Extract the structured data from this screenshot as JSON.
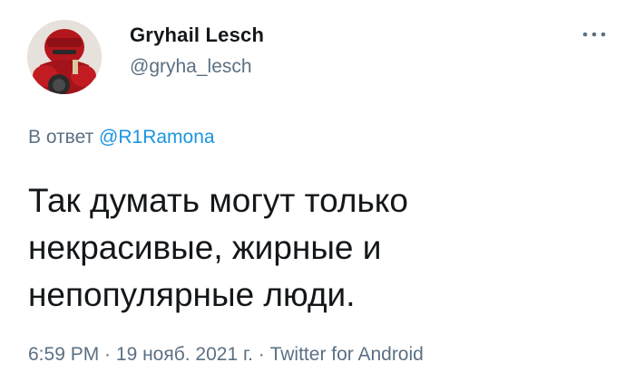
{
  "author": {
    "display_name": "Gryhail Lesch",
    "handle": "@gryha_lesch",
    "avatar_icon": "armored-helmet-avatar"
  },
  "more_icon": "three-dots-icon",
  "reply": {
    "prefix": "В ответ",
    "mention": "@R1Ramona"
  },
  "tweet": {
    "lines": [
      "Так думать могут только",
      "некрасивые, жирные и",
      "непопулярные люди."
    ]
  },
  "meta": {
    "time": "6:59 PM",
    "separator_1": " · ",
    "date": "19 нояб. 2021 г.",
    "separator_2": " · ",
    "source": "Twitter for Android"
  },
  "colors": {
    "text": "#14171a",
    "secondary": "#5b7083",
    "link": "#1b95e0",
    "background": "#ffffff"
  }
}
